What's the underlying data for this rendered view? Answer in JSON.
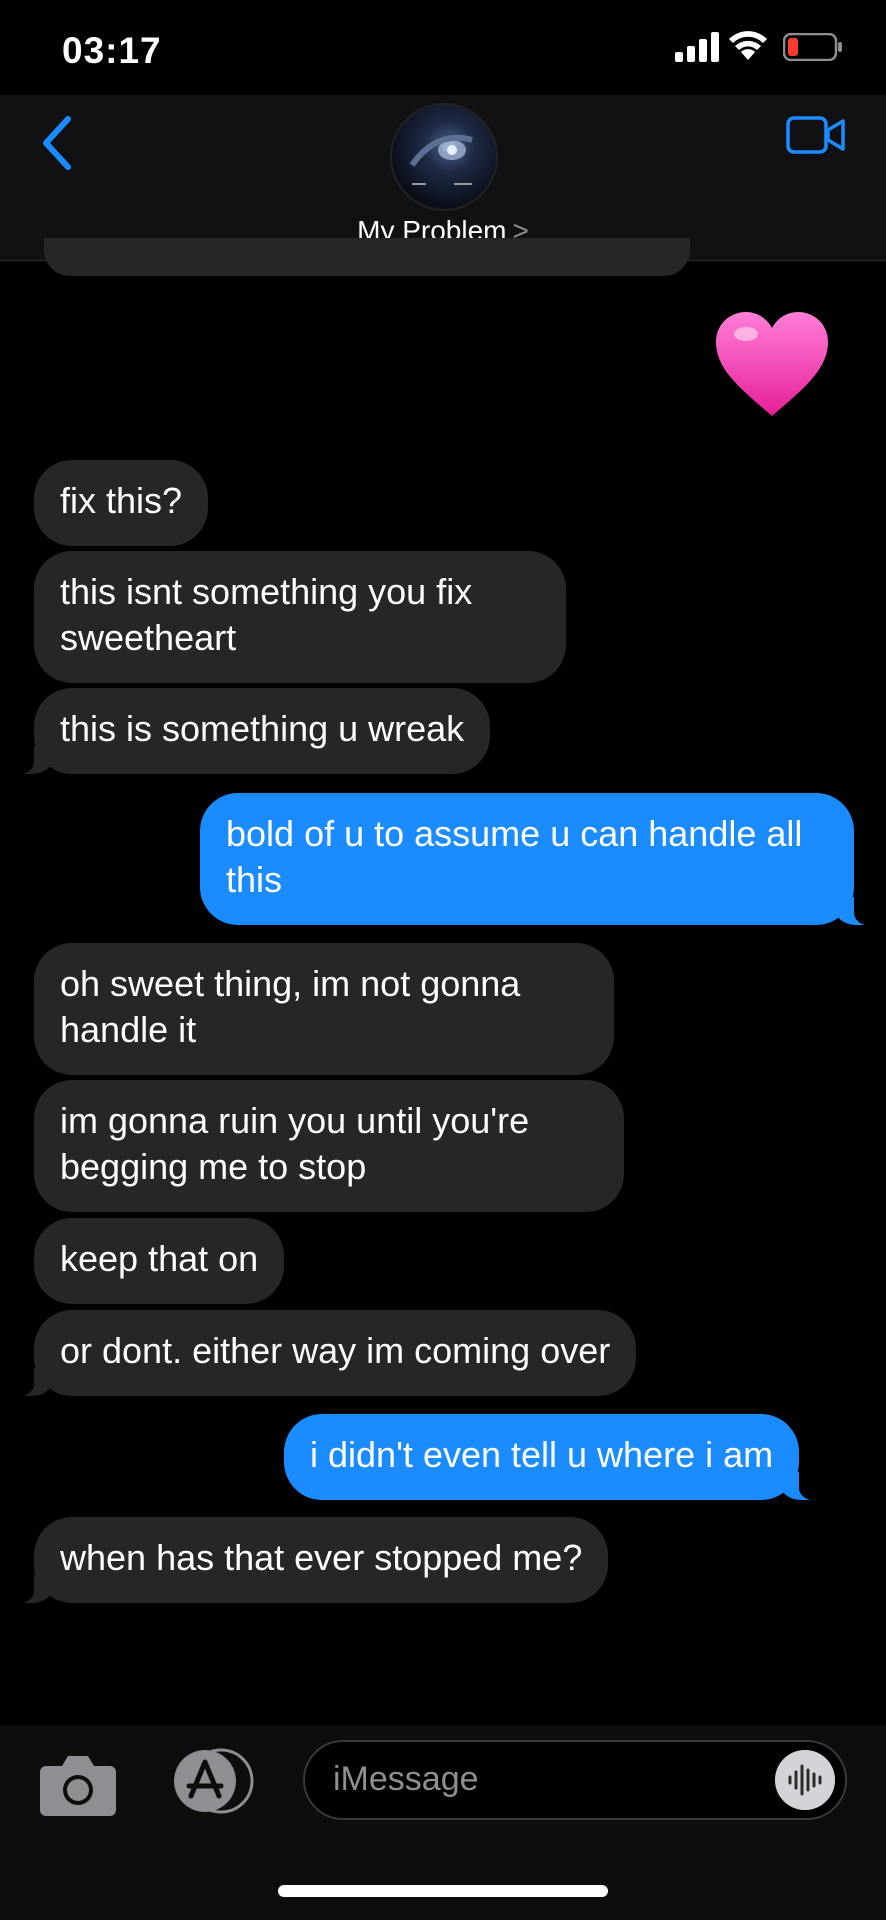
{
  "status_bar": {
    "time": "03:17",
    "battery_color": "#ff3b30"
  },
  "header": {
    "contact_name": "My Problem",
    "chevron": ">",
    "back_icon": "chevron-left-icon",
    "video_icon": "video-camera-icon",
    "accent_color": "#1a8cff"
  },
  "messages": [
    {
      "from": "me",
      "type": "emoji",
      "text": "💗"
    },
    {
      "from": "them",
      "text": "fix this?"
    },
    {
      "from": "them",
      "text": "this isnt something you fix sweetheart"
    },
    {
      "from": "them",
      "text": "this is something u wreak"
    },
    {
      "from": "me",
      "text": "bold of u to assume u can handle all this"
    },
    {
      "from": "them",
      "text": "oh sweet thing, im not gonna handle it"
    },
    {
      "from": "them",
      "text": "im gonna ruin you until you're begging me to stop"
    },
    {
      "from": "them",
      "text": "keep that on"
    },
    {
      "from": "them",
      "text": "or dont. either way im coming over"
    },
    {
      "from": "me",
      "text": "i didn't even tell u where i am"
    },
    {
      "from": "them",
      "text": "when has that ever stopped me?"
    }
  ],
  "composer": {
    "placeholder": "iMessage",
    "camera_icon": "camera-icon",
    "apps_icon": "app-store-icon",
    "audio_icon": "audio-waveform-icon"
  }
}
